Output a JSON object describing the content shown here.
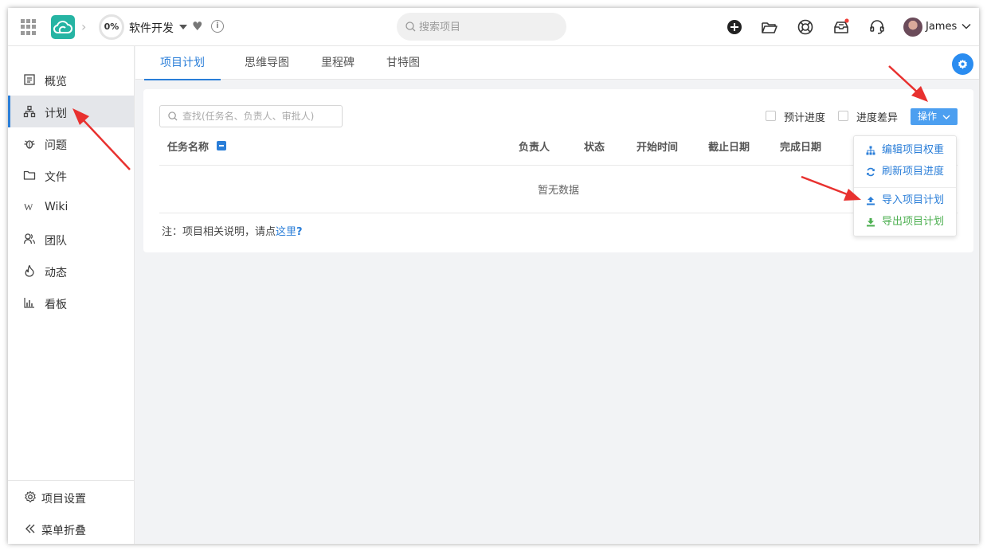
{
  "header": {
    "progress": "0%",
    "project_name": "软件开发",
    "search_placeholder": "搜索项目",
    "user_name": "James"
  },
  "sidebar": {
    "items": [
      {
        "label": "概览"
      },
      {
        "label": "计划"
      },
      {
        "label": "问题"
      },
      {
        "label": "文件"
      },
      {
        "label": "Wiki"
      },
      {
        "label": "团队"
      },
      {
        "label": "动态"
      },
      {
        "label": "看板"
      }
    ],
    "active_index": 1,
    "bottom": {
      "settings": "项目设置",
      "collapse": "菜单折叠"
    }
  },
  "tabs": [
    {
      "label": "项目计划"
    },
    {
      "label": "思维导图"
    },
    {
      "label": "里程碑"
    },
    {
      "label": "甘特图"
    }
  ],
  "active_tab": 0,
  "plan": {
    "search_placeholder": "查找(任务名、负责人、审批人)",
    "checkbox_expected": "预计进度",
    "checkbox_diff": "进度差异",
    "action_button": "操作",
    "columns": {
      "name": "任务名称",
      "owner": "负责人",
      "status": "状态",
      "start": "开始时间",
      "deadline": "截止日期",
      "finish": "完成日期"
    },
    "empty": "暂无数据",
    "note_prefix": "注：项目相关说明，请点",
    "note_link": "这里",
    "note_suffix": "?"
  },
  "action_menu": {
    "edit_weight": "编辑项目权重",
    "refresh_progress": "刷新项目进度",
    "import_plan": "导入项目计划",
    "export_plan": "导出项目计划"
  },
  "colors": {
    "accent": "#2a7ed8",
    "button": "#4c9ff0",
    "export_green": "#4caf50",
    "annotation_red": "#e8312f"
  },
  "icons": {
    "apps": "grid-icon",
    "logo": "cloud-logo-icon",
    "add": "plus-circle-icon",
    "folder": "folder-open-icon",
    "help": "lifebuoy-icon",
    "inbox": "inbox-icon",
    "support": "headset-icon",
    "settings": "gear-icon"
  }
}
